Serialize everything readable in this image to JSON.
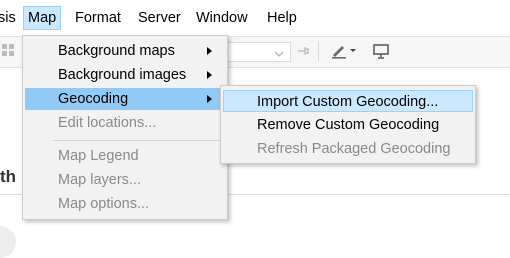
{
  "menubar": {
    "items": [
      {
        "label": "sis"
      },
      {
        "label": "Map"
      },
      {
        "label": "Format"
      },
      {
        "label": "Server"
      },
      {
        "label": "Window"
      },
      {
        "label": "Help"
      }
    ]
  },
  "map_menu": {
    "items": [
      {
        "label": "Background maps"
      },
      {
        "label": "Background images"
      },
      {
        "label": "Geocoding"
      },
      {
        "label": "Edit locations..."
      },
      {
        "label": "Map Legend"
      },
      {
        "label": "Map layers..."
      },
      {
        "label": "Map options..."
      }
    ]
  },
  "geocoding_menu": {
    "items": [
      {
        "label": "Import Custom Geocoding..."
      },
      {
        "label": "Remove Custom Geocoding"
      },
      {
        "label": "Refresh Packaged Geocoding"
      }
    ]
  },
  "background": {
    "partial_heading": "th"
  },
  "colors": {
    "menu_bg": "#f2f2f2",
    "highlight": "#91c9f7",
    "hover": "#cce8ff",
    "disabled_text": "#8a8a8a"
  }
}
